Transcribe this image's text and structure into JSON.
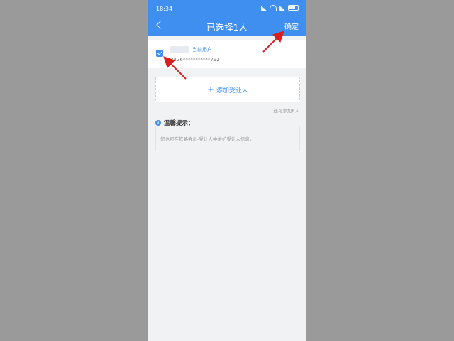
{
  "status_bar": {
    "time": "18:34"
  },
  "nav": {
    "title": "已选择1人",
    "confirm_label": "确定"
  },
  "user": {
    "tag": "当前用户",
    "id_masked": "3426***********792",
    "checked": true
  },
  "add_button": {
    "plus": "+",
    "label": "添加受让人"
  },
  "remaining_text": "还可添加8人",
  "tip": {
    "title": "温馨提示：",
    "text": "您也可在铁路会员-受让人中维护受让人信息。"
  },
  "colors": {
    "accent": "#3f8ff0",
    "annotation_arrow": "#d81f1f"
  }
}
